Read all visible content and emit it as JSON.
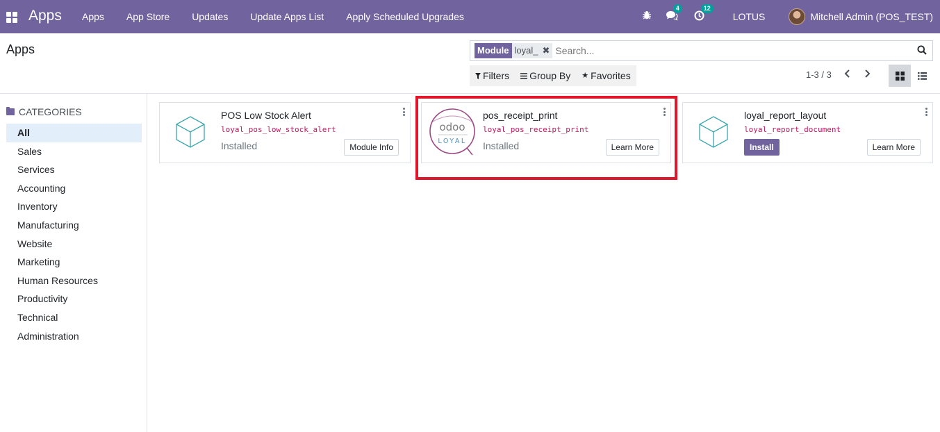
{
  "navbar": {
    "brand": "Apps",
    "menu": [
      "Apps",
      "App Store",
      "Updates",
      "Update Apps List",
      "Apply Scheduled Upgrades"
    ],
    "messages_count": "4",
    "activities_count": "12",
    "company": "LOTUS",
    "user": "Mitchell Admin (POS_TEST)"
  },
  "control_panel": {
    "title": "Apps",
    "facet_name": "Module",
    "facet_value": "loyal_",
    "search_placeholder": "Search...",
    "filters_label": "Filters",
    "groupby_label": "Group By",
    "favorites_label": "Favorites",
    "pager": "1-3 / 3"
  },
  "sidebar": {
    "header": "CATEGORIES",
    "items": [
      "All",
      "Sales",
      "Services",
      "Accounting",
      "Inventory",
      "Manufacturing",
      "Website",
      "Marketing",
      "Human Resources",
      "Productivity",
      "Technical",
      "Administration"
    ]
  },
  "cards": [
    {
      "title": "POS Low Stock Alert",
      "technical": "loyal_pos_low_stock_alert",
      "status": "Installed",
      "button": "Module Info"
    },
    {
      "title": "pos_receipt_print",
      "technical": "loyal_pos_receipt_print",
      "status": "Installed",
      "button": "Learn More",
      "logo_top": "odoo",
      "logo_bottom": "LOYAL"
    },
    {
      "title": "loyal_report_layout",
      "technical": "loyal_report_document",
      "install_label": "Install",
      "button": "Learn More"
    }
  ],
  "colors": {
    "brand": "#71639e",
    "highlight": "#e0162b",
    "technical_name": "#c2185b"
  }
}
